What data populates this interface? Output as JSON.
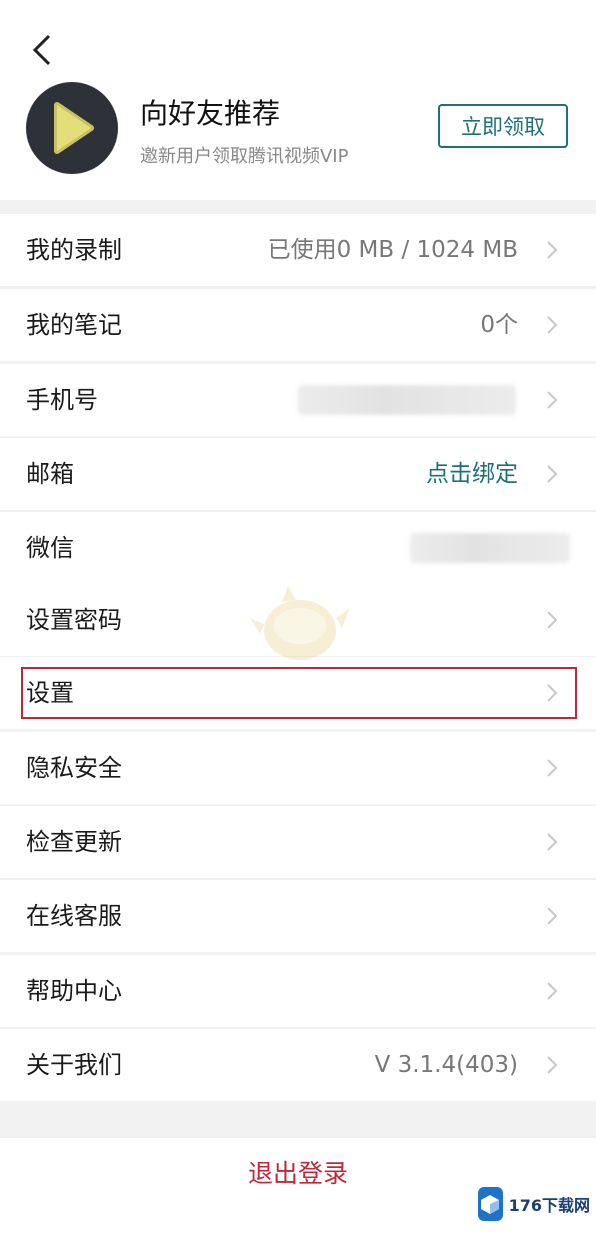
{
  "header": {
    "back_icon": "chevron-left-icon",
    "logo_icon": "play-icon",
    "promo_title": "向好友推荐",
    "promo_subtitle": "邀新用户领取腾讯视频VIP",
    "claim_button": "立即领取"
  },
  "menu": {
    "recording": {
      "label": "我的录制",
      "value": "已使用0 MB / 1024 MB"
    },
    "notes": {
      "label": "我的笔记",
      "value": "0个"
    },
    "phone": {
      "label": "手机号"
    },
    "email": {
      "label": "邮箱",
      "value": "点击绑定"
    },
    "wechat": {
      "label": "微信"
    },
    "password": {
      "label": "设置密码"
    },
    "settings": {
      "label": "设置"
    },
    "privacy": {
      "label": "隐私安全"
    },
    "update": {
      "label": "检查更新"
    },
    "service": {
      "label": "在线客服"
    },
    "help": {
      "label": "帮助中心"
    },
    "about": {
      "label": "关于我们",
      "value": "V 3.1.4(403)"
    }
  },
  "logout": {
    "label": "退出登录"
  },
  "watermark": {
    "site": "176下载网"
  },
  "colors": {
    "accent": "#1f6f7a",
    "danger": "#c0283a",
    "background": "#f2f2f2"
  }
}
